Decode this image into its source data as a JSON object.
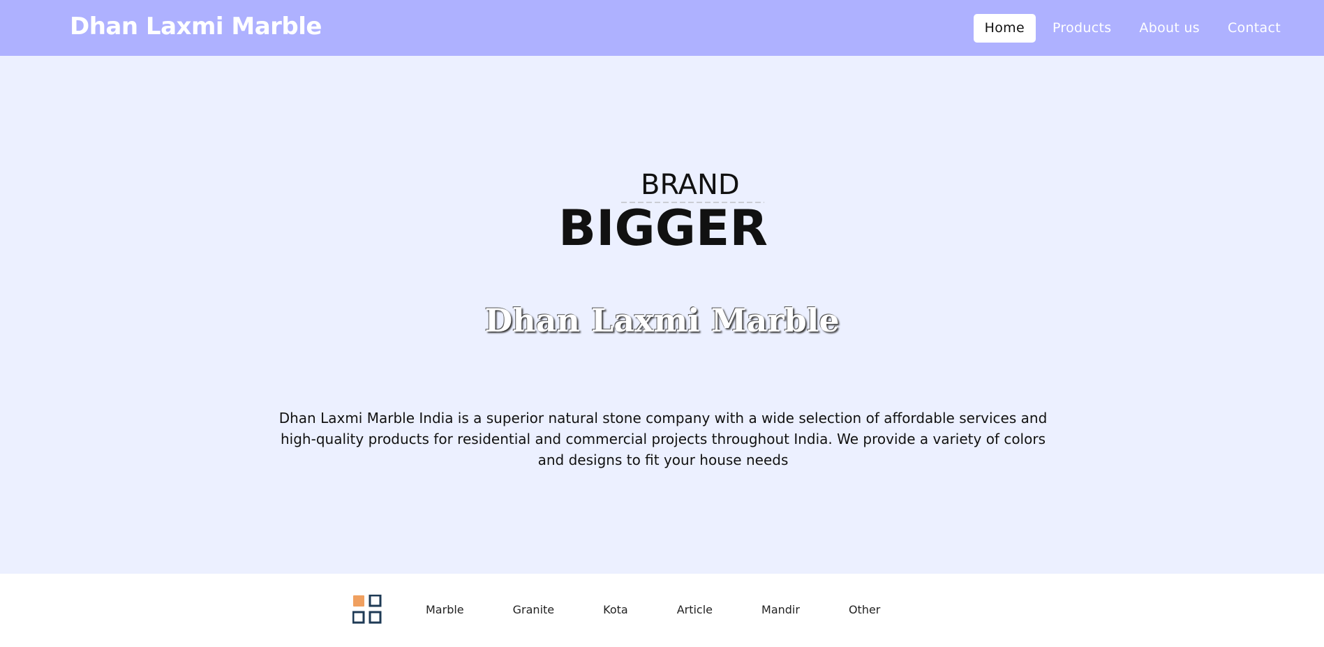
{
  "header": {
    "brand": "Dhan Laxmi Marble",
    "nav": [
      {
        "label": "Home"
      },
      {
        "label": "Products"
      },
      {
        "label": "About us"
      },
      {
        "label": "Contact"
      }
    ]
  },
  "hero": {
    "logo": {
      "line1": "BRAND",
      "line2": "BIGGER"
    },
    "title": "Dhan Laxmi Marble",
    "description": "Dhan Laxmi Marble India is a superior natural stone company with a wide selection of affordable services and high-quality products for residential and commercial projects throughout India. We provide a variety of colors and designs to fit your house needs"
  },
  "categories": {
    "icon": "grid-icon",
    "items": [
      "Marble",
      "Granite",
      "Kota",
      "Article",
      "Mandir",
      "Other"
    ]
  },
  "colors": {
    "navbar": "#aeb1ff",
    "background": "#ecf0ff",
    "icon_accent": "#f0a060",
    "icon_dark": "#1e3a55"
  }
}
